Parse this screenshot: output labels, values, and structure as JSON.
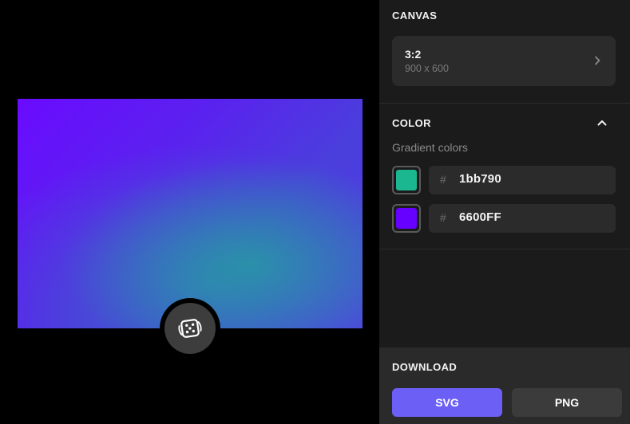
{
  "canvas_section": {
    "title": "CANVAS",
    "ratio": "3:2",
    "dimensions": "900 x 600",
    "chevron_icon": "chevron-right-icon"
  },
  "color_section": {
    "title": "COLOR",
    "collapse_icon": "chevron-up-icon",
    "gradient_label": "Gradient colors",
    "colors": [
      {
        "hash": "#",
        "value": "1bb790",
        "swatch": "#1bb790"
      },
      {
        "hash": "#",
        "value": "6600FF",
        "swatch": "#6600ff"
      }
    ]
  },
  "download_section": {
    "title": "DOWNLOAD",
    "svg_label": "SVG",
    "png_label": "PNG"
  },
  "preview": {
    "random_icon": "dice-icon"
  },
  "accent_color": "#6c5ff5"
}
